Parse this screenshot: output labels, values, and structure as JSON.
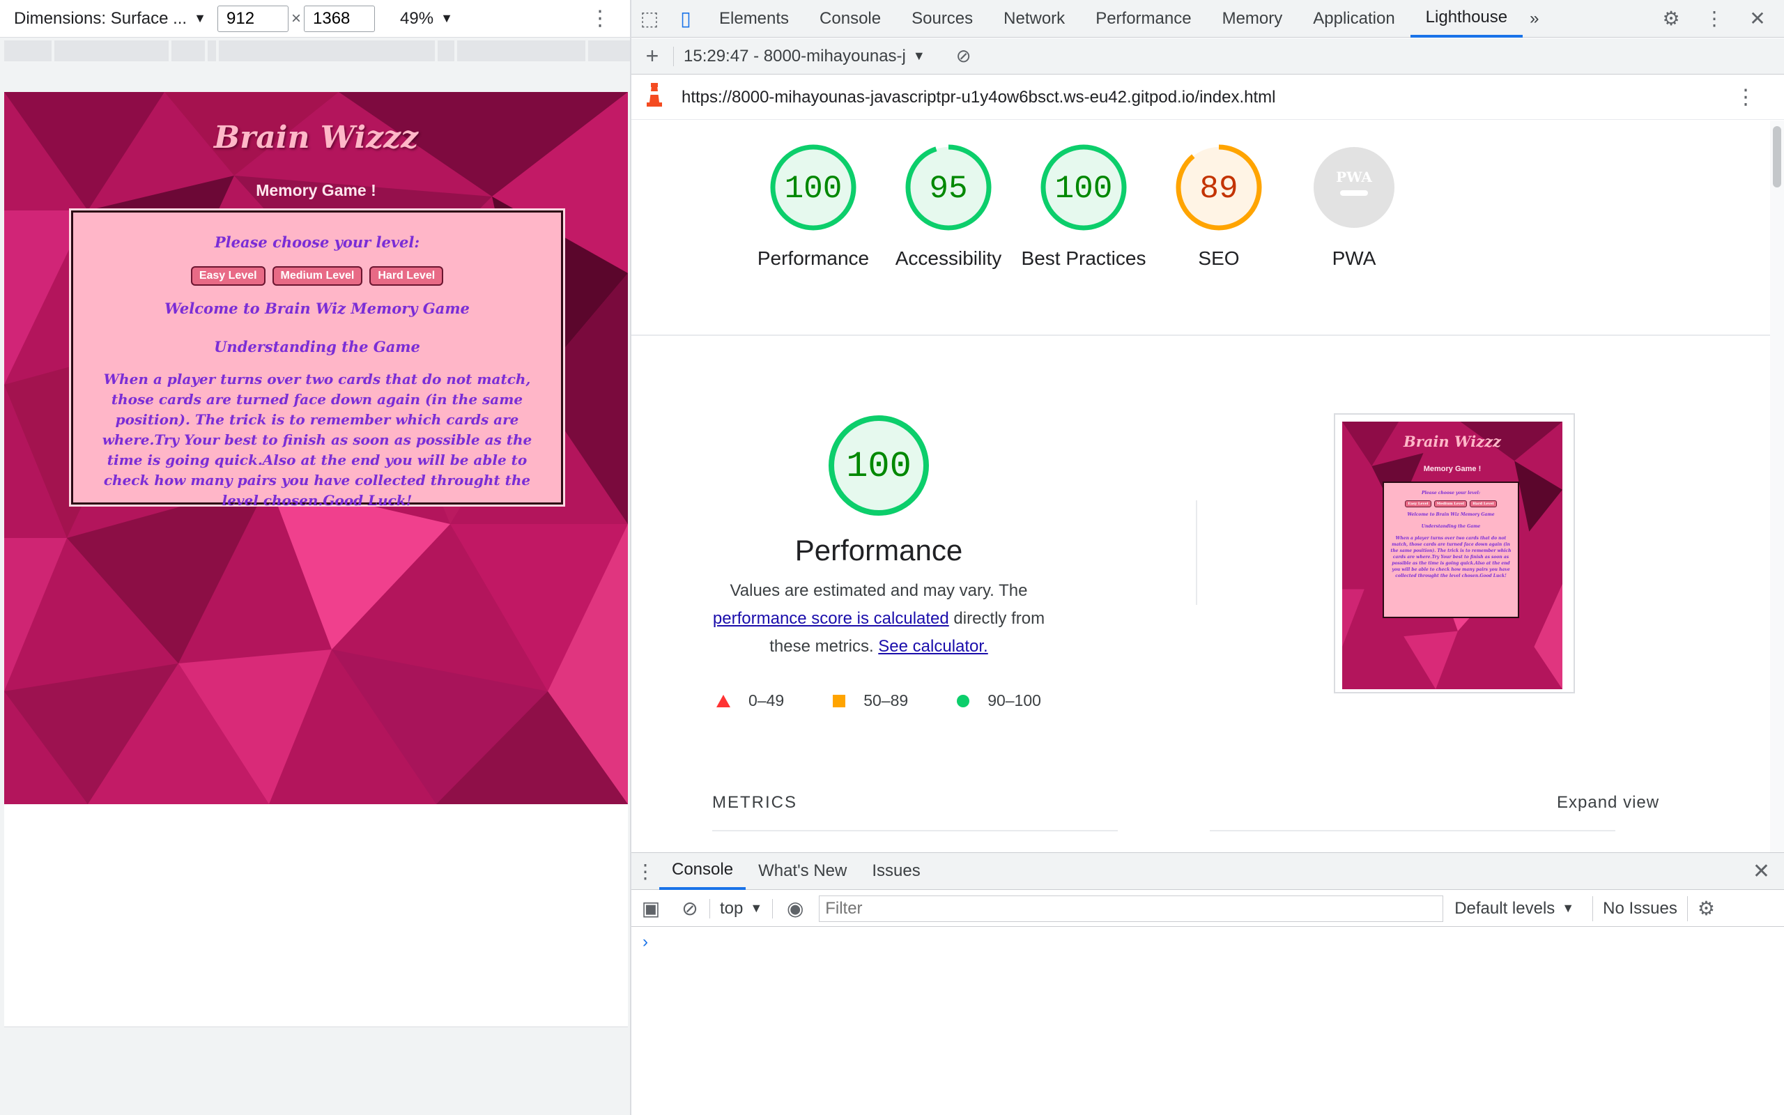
{
  "device_toolbar": {
    "dimensions_label": "Dimensions: Surface ...",
    "width_value": "912",
    "height_value": "1368",
    "times_sign": "×",
    "zoom_label": "49%",
    "dropdown_arrow": "▼"
  },
  "game": {
    "title": "Brain Wizzz",
    "subtitle": "Memory Game !",
    "choose_level": "Please choose your level:",
    "buttons": [
      "Easy Level",
      "Medium Level",
      "Hard Level"
    ],
    "welcome": "Welcome to Brain Wiz Memory Game",
    "understanding": "Understanding the Game",
    "instructions": "When a player turns over two cards that do not match, those cards are turned face down again (in the same position). The trick is to remember which cards are where.Try Your best to finish as soon as possible as the time is going quick.Also at the end you will be able to check how many pairs you have collected throught the level chosen.Good Luck!"
  },
  "devtools": {
    "tabs": [
      "Elements",
      "Console",
      "Sources",
      "Network",
      "Performance",
      "Memory",
      "Application",
      "Lighthouse"
    ],
    "active_tab": "Lighthouse",
    "overflow": "»",
    "report_select": "15:29:47 - 8000-mihayounas-j",
    "url": "https://8000-mihayounas-javascriptpr-u1y4ow6bsct.ws-eu42.gitpod.io/index.html"
  },
  "scores": [
    {
      "label": "Performance",
      "value": 100,
      "color": "#0cce6b",
      "text_color": "#008800",
      "fill": "#e6f9ee"
    },
    {
      "label": "Accessibility",
      "value": 95,
      "color": "#0cce6b",
      "text_color": "#008800",
      "fill": "#e6f9ee"
    },
    {
      "label": "Best Practices",
      "value": 100,
      "color": "#0cce6b",
      "text_color": "#008800",
      "fill": "#e6f9ee"
    },
    {
      "label": "SEO",
      "value": 89,
      "color": "#ffa400",
      "text_color": "#c33300",
      "fill": "#fff4e5"
    },
    {
      "label": "PWA",
      "value": null,
      "color": "#e2e2e2",
      "text_color": "#ffffff",
      "fill": "#e2e2e2"
    }
  ],
  "pwa_badge": "PWA",
  "performance": {
    "score": 100,
    "title": "Performance",
    "desc_before": "Values are estimated and may vary. The ",
    "link_score": "performance score is calculated",
    "desc_middle": " directly from these metrics. ",
    "link_calc": "See calculator.",
    "legend": [
      {
        "range": "0–49",
        "shape": "triangle",
        "color": "#ff3333"
      },
      {
        "range": "50–89",
        "shape": "square",
        "color": "#ffa400"
      },
      {
        "range": "90–100",
        "shape": "circle",
        "color": "#0cce6b"
      }
    ]
  },
  "metrics": {
    "label": "METRICS",
    "expand": "Expand view"
  },
  "drawer": {
    "tabs": [
      "Console",
      "What's New",
      "Issues"
    ],
    "active_tab": "Console",
    "context": "top",
    "filter_placeholder": "Filter",
    "levels": "Default levels",
    "issues_button": "No Issues",
    "prompt": "›"
  }
}
